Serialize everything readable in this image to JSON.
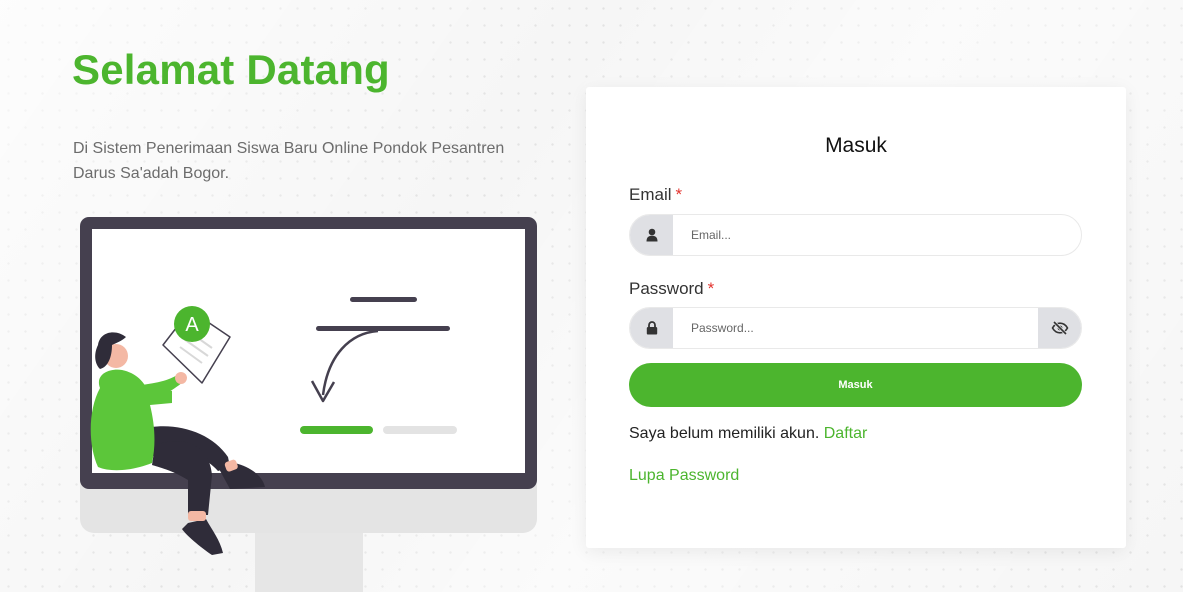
{
  "welcome": {
    "title": "Selamat Datang",
    "description": "Di Sistem Penerimaan Siswa Baru Online Pondok Pesantren Darus Sa'adah Bogor."
  },
  "illustration": {
    "badge_letter": "A"
  },
  "login": {
    "title": "Masuk",
    "email": {
      "label": "Email",
      "required_mark": "*",
      "placeholder": "Email...",
      "value": "",
      "icon": "user-icon"
    },
    "password": {
      "label": "Password",
      "required_mark": "*",
      "placeholder": "Password...",
      "value": "",
      "icon": "lock-icon",
      "toggle_icon": "eye-slash-icon"
    },
    "submit_label": "Masuk",
    "register_prompt": "Saya belum memiliki akun.",
    "register_link": "Daftar",
    "forgot_link": "Lupa Password"
  },
  "colors": {
    "brand_green": "#4cb52e",
    "monitor_frame": "#45404f",
    "addon_bg": "#dfe0e4",
    "required": "#e3342f"
  }
}
